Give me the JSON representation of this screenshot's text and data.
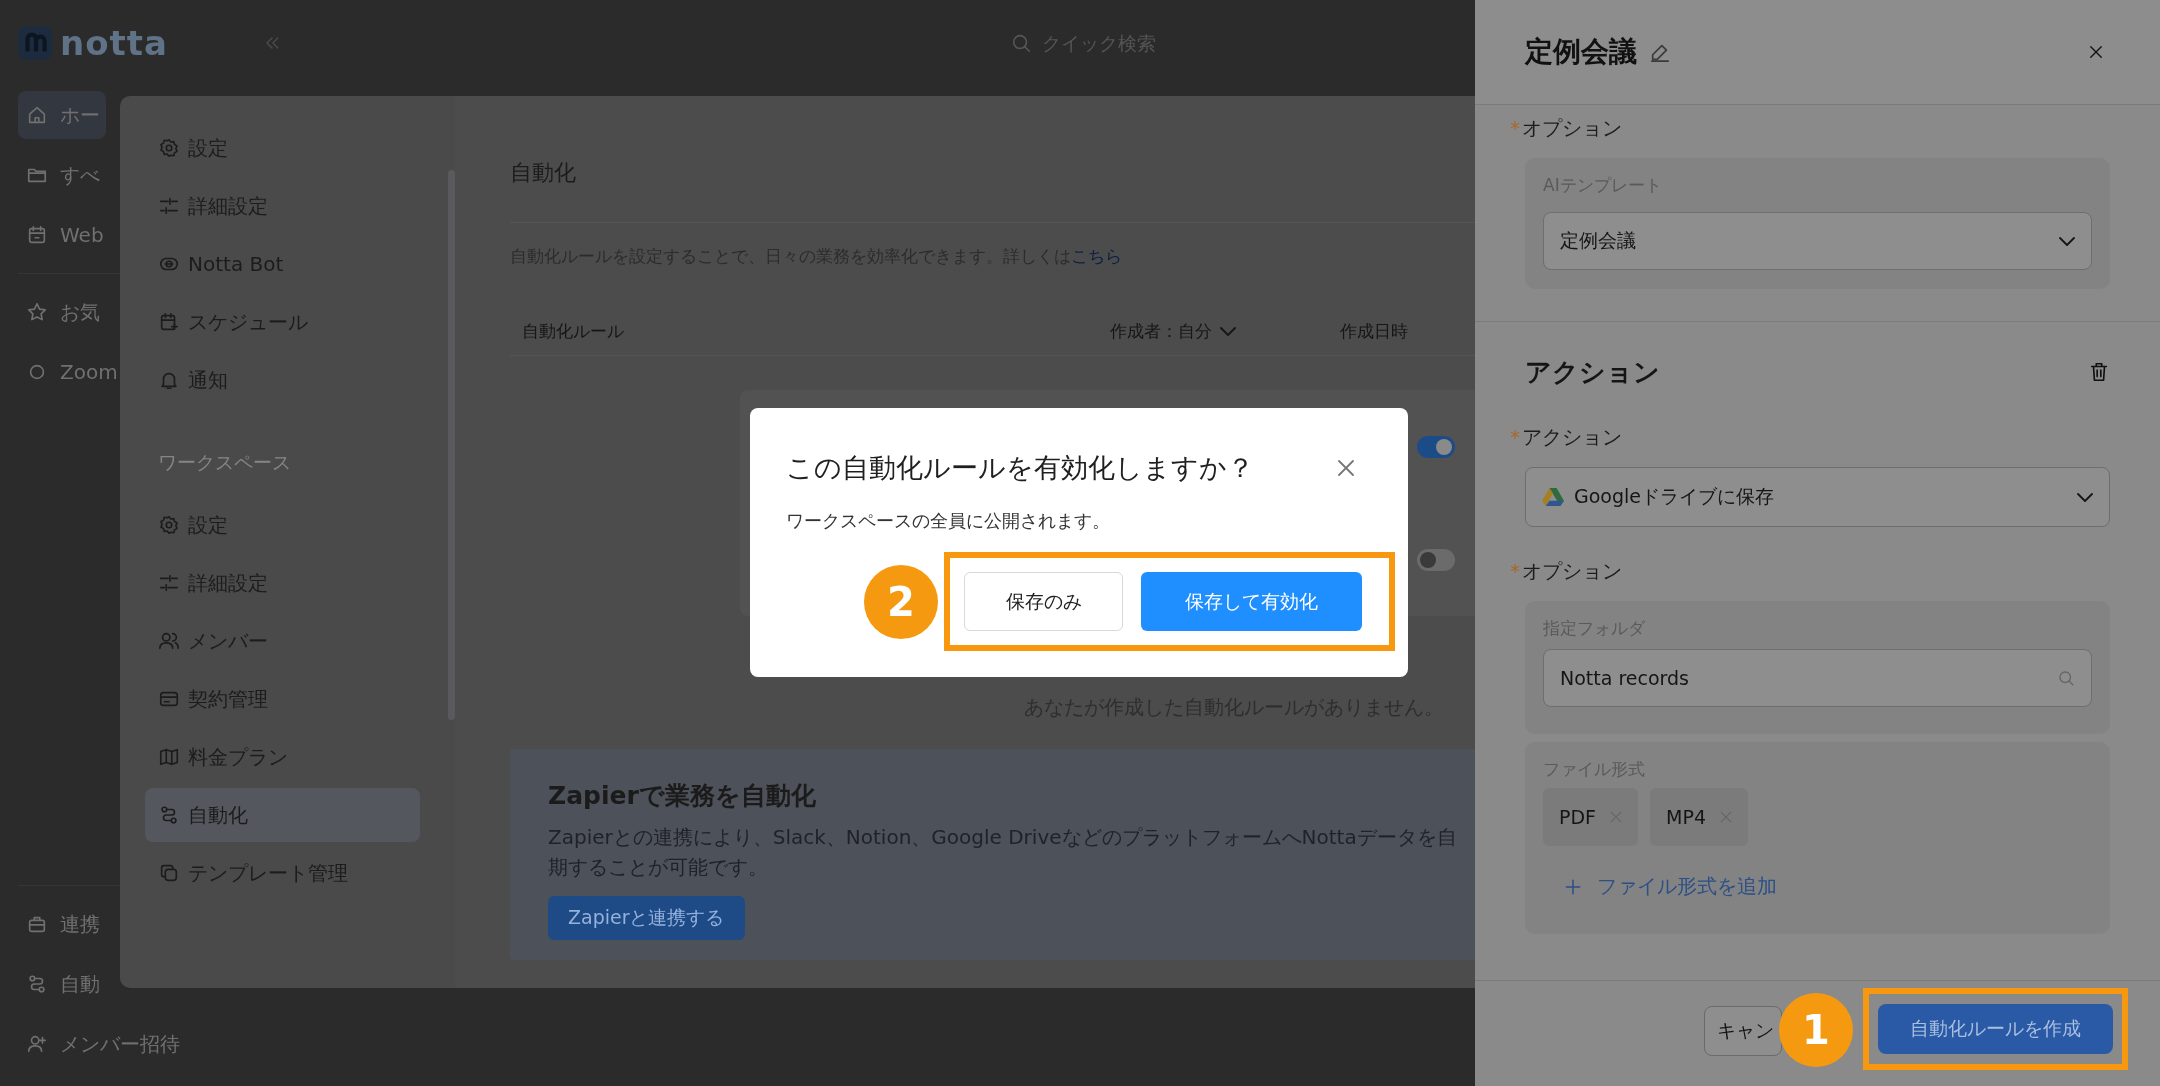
{
  "app": {
    "logo_text": "notta",
    "search": {
      "placeholder": "クイック検索"
    },
    "sidebar": {
      "items": [
        {
          "label": "ホー",
          "selected": true
        },
        {
          "label": "すべ",
          "selected": false
        },
        {
          "label": "Web",
          "selected": false
        },
        {
          "label": "お気",
          "selected": false
        },
        {
          "label": "Zoom",
          "selected": false
        }
      ],
      "bottom_items": [
        {
          "label": "連携",
          "selected": false
        },
        {
          "label": "自動",
          "selected": false
        },
        {
          "label": "メンバー招待",
          "selected": false
        }
      ]
    }
  },
  "settings": {
    "personal_items": [
      {
        "label": "設定",
        "selected": false
      },
      {
        "label": "詳細設定",
        "selected": false
      },
      {
        "label": "Notta Bot",
        "selected": false
      },
      {
        "label": "スケジュール",
        "selected": false
      },
      {
        "label": "通知",
        "selected": false
      }
    ],
    "section_label": "ワークスペース",
    "workspace_items": [
      {
        "label": "設定",
        "selected": false
      },
      {
        "label": "詳細設定",
        "selected": false
      },
      {
        "label": "メンバー",
        "selected": false
      },
      {
        "label": "契約管理",
        "selected": false
      },
      {
        "label": "料金プラン",
        "selected": false
      },
      {
        "label": "自動化",
        "selected": true
      },
      {
        "label": "テンプレート管理",
        "selected": false
      }
    ],
    "page": {
      "title": "自動化",
      "description": "自動化ルールを設定することで、日々の業務を効率化できます。詳しくは",
      "link": "こちら",
      "table": {
        "columns": [
          "自動化ルール",
          "作成者：自分",
          "作成日時"
        ]
      },
      "toggles": [
        {
          "on": true
        },
        {
          "on": false
        }
      ],
      "empty_message": "あなたが作成した自動化ルールがありません。",
      "zapier": {
        "title": "Zapierで業務を自動化",
        "lines": [
          "Zapierとの連携により、Slack、Notion、Google DriveなどのプラットフォームへNottaデータを自",
          "期することが可能です。"
        ],
        "button": "Zapierと連携する"
      }
    }
  },
  "dialog": {
    "title": "この自動化ルールを有効化しますか？",
    "message": "ワークスペースの全員に公開されます。",
    "step": "2",
    "buttons": [
      {
        "label": "保存のみ",
        "kind": "secondary"
      },
      {
        "label": "保存して有効化",
        "kind": "primary"
      }
    ]
  },
  "drawer": {
    "title": "定例会議",
    "trigger_option": {
      "mark": "*",
      "label": "オプション",
      "field_label": "AIテンプレート",
      "value": "定例会議"
    },
    "action": {
      "heading": "アクション",
      "mark": "*",
      "label": "アクション",
      "value": "Googleドライブに保存"
    },
    "action_option": {
      "mark": "*",
      "label": "オプション",
      "folder_label": "指定フォルダ",
      "folder_value": "Notta records",
      "format_label": "ファイル形式",
      "formats": [
        "PDF",
        "MP4"
      ],
      "add_format": "ファイル形式を追加"
    },
    "footer": {
      "cancel": "キャン",
      "submit": "自動化ルールを作成",
      "step": "1"
    }
  }
}
